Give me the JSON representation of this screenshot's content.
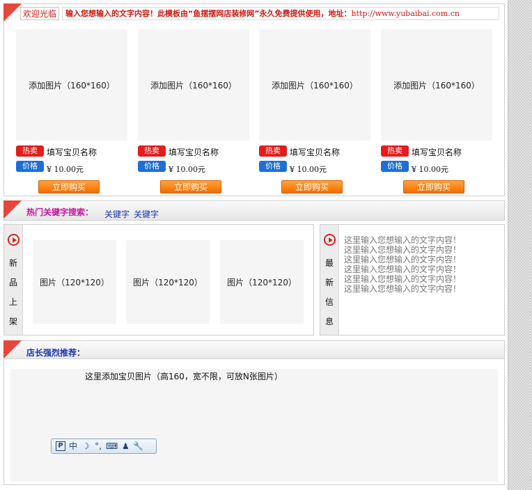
{
  "welcome": {
    "label": "欢迎光临",
    "announcement": "输入您想输入的文字内容！此模板由“鱼摆摆网店装修网”永久免费提供使用，地址：",
    "url": "http://www.yubaibai.com.cn"
  },
  "products": [
    {
      "image_text": "添加图片（160*160）",
      "hot_tag": "热卖",
      "name": "填写宝贝名称",
      "price_tag": "价格",
      "price": "¥ 10.00元",
      "buy_label": "立即购买"
    },
    {
      "image_text": "添加图片（160*160）",
      "hot_tag": "热卖",
      "name": "填写宝贝名称",
      "price_tag": "价格",
      "price": "¥ 10.00元",
      "buy_label": "立即购买"
    },
    {
      "image_text": "添加图片（160*160）",
      "hot_tag": "热卖",
      "name": "填写宝贝名称",
      "price_tag": "价格",
      "price": "¥ 10.00元",
      "buy_label": "立即购买"
    },
    {
      "image_text": "添加图片（160*160）",
      "hot_tag": "热卖",
      "name": "填写宝贝名称",
      "price_tag": "价格",
      "price": "¥ 10.00元",
      "buy_label": "立即购买"
    }
  ],
  "keywords": {
    "title": "热门关键字搜索：",
    "items": [
      "关键字",
      "关键字"
    ]
  },
  "new_arrivals": {
    "label_chars": [
      "新",
      "品",
      "上",
      "架"
    ],
    "images": [
      "图片（120*120）",
      "图片（120*120）",
      "图片（120*120）"
    ]
  },
  "latest_info": {
    "label_chars": [
      "最",
      "新",
      "信",
      "息"
    ],
    "lines": [
      "这里输入您想输入的文字内容！",
      "这里输入您想输入的文字内容！",
      "这里输入您想输入的文字内容！",
      "这里输入您想输入的文字内容！",
      "这里输入您想输入的文字内容！",
      "这里输入您想输入的文字内容！"
    ]
  },
  "recommend": {
    "title": "店长强烈推荐：",
    "placeholder": "这里添加宝贝图片（高160，宽不限，可放N张图片）"
  },
  "ime_toolbar": {
    "items": [
      {
        "icon": "p-icon",
        "text": "P"
      },
      {
        "icon": "chinese-mode",
        "text": "中"
      },
      {
        "icon": "moon-icon",
        "text": "☽"
      },
      {
        "icon": "punctuation-icon",
        "text": "°,"
      },
      {
        "icon": "keyboard-icon",
        "text": "⌨"
      },
      {
        "icon": "user-icon",
        "text": "♟"
      },
      {
        "icon": "wrench-icon",
        "text": "🔧"
      }
    ]
  },
  "colors": {
    "accent_red": "#e31b1b",
    "price_blue": "#1e6fd6",
    "buy_orange": "#f06d00"
  }
}
